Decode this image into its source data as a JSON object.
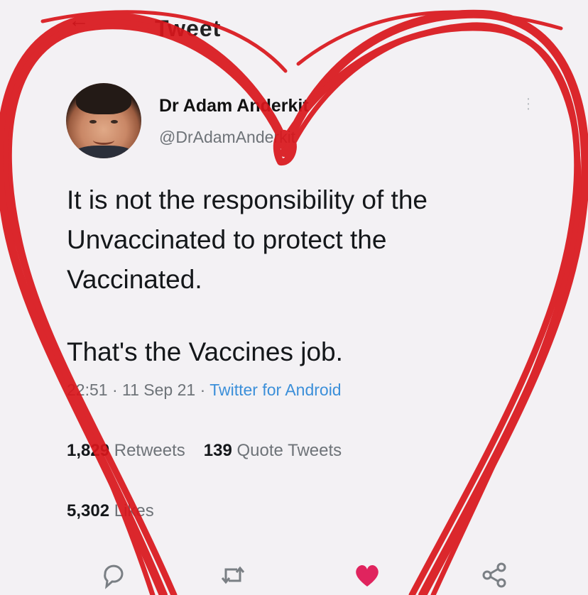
{
  "header": {
    "title": "Tweet"
  },
  "author": {
    "display_name": "Dr Adam Anderkit",
    "handle": "@DrAdamAnderkit"
  },
  "tweet": {
    "lines": [
      "It is not the responsibility of the",
      "Unvaccinated to protect the",
      "Vaccinated."
    ],
    "second_paragraph": "That's the Vaccines job."
  },
  "meta": {
    "time": "22:51",
    "date": "11 Sep 21",
    "separator": "·",
    "source": "Twitter for Android"
  },
  "stats": {
    "retweets_count": "1,829",
    "retweets_label": "Retweets",
    "quotes_count": "139",
    "quotes_label": "Quote Tweets",
    "likes_count": "5,302",
    "likes_label": "Likes"
  },
  "icons": {
    "back": "back-arrow-icon",
    "more": "more-vertical-icon",
    "reply": "reply-icon",
    "retweet": "retweet-icon",
    "like": "heart-icon",
    "share": "share-icon"
  },
  "colors": {
    "accent": "#3b8fd9",
    "like_active": "#e0245e",
    "overlay_heart": "#d9161c"
  }
}
